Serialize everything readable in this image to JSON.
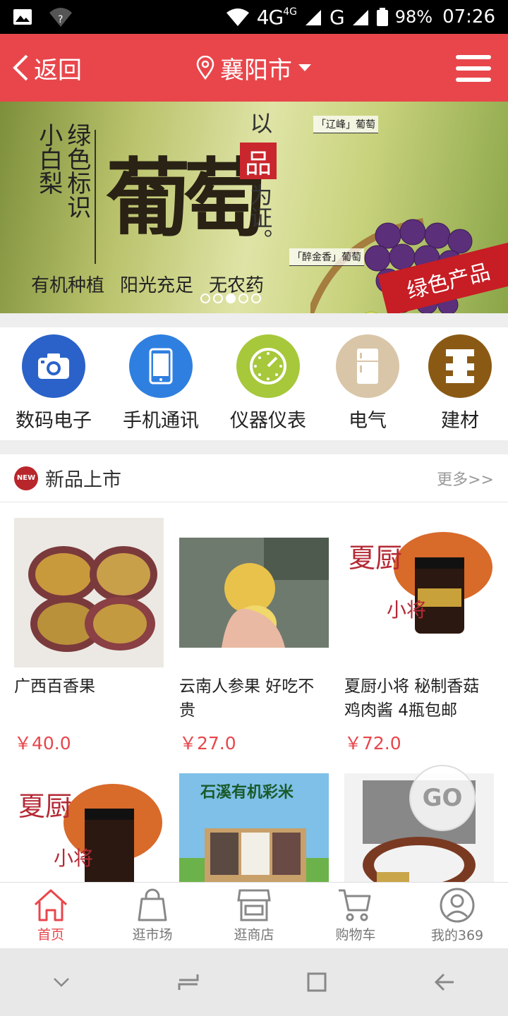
{
  "status_bar": {
    "network": "4G",
    "network_small": "4G",
    "g_label": "G",
    "battery": "98%",
    "time": "07:26"
  },
  "header": {
    "back_label": "返回",
    "city": "襄阳市"
  },
  "banner": {
    "vertical_lines": [
      "小白梨",
      "绿色标识"
    ],
    "main_title": "葡萄",
    "badge_char": "品",
    "side_text": [
      "以",
      "为证。"
    ],
    "tag_purple": "「辽峰」葡萄",
    "tag_green": "「醉金香」葡萄",
    "slogans": [
      "有机种植",
      "阳光充足",
      "无农药"
    ],
    "corner_badge": "绿色产品",
    "slide_count": 5,
    "active_slide": 3
  },
  "categories": [
    {
      "label": "数码电子",
      "icon": "camera-icon",
      "color": "#2a62c9"
    },
    {
      "label": "手机通讯",
      "icon": "phone-icon",
      "color": "#2f7fe0"
    },
    {
      "label": "仪器仪表",
      "icon": "gauge-icon",
      "color": "#a6c83a"
    },
    {
      "label": "电气",
      "icon": "fridge-icon",
      "color": "#d9c6a8"
    },
    {
      "label": "建材",
      "icon": "brick-icon",
      "color": "#8a5a14"
    }
  ],
  "new_arrivals": {
    "badge": "NEW",
    "title": "新品上市",
    "more": "更多>>",
    "products": [
      {
        "name": "广西百香果",
        "price": "￥40.0"
      },
      {
        "name": "云南人参果 好吃不贵",
        "price": "￥27.0"
      },
      {
        "name": "夏厨小将 秘制香菇鸡肉酱 4瓶包邮",
        "price": "￥72.0"
      }
    ],
    "second_row_banner_text": "石溪有机彩米",
    "xiachu_text": "夏厨",
    "xiaojiang_text": "小将"
  },
  "go_button": "GO",
  "tabs": [
    {
      "label": "首页",
      "icon": "home-icon",
      "active": true
    },
    {
      "label": "逛市场",
      "icon": "bag-icon",
      "active": false
    },
    {
      "label": "逛商店",
      "icon": "store-icon",
      "active": false
    },
    {
      "label": "购物车",
      "icon": "cart-icon",
      "active": false
    },
    {
      "label": "我的369",
      "icon": "user-icon",
      "active": false
    }
  ],
  "colors": {
    "brand_red": "#e8464b",
    "price_red": "#e8464b"
  }
}
